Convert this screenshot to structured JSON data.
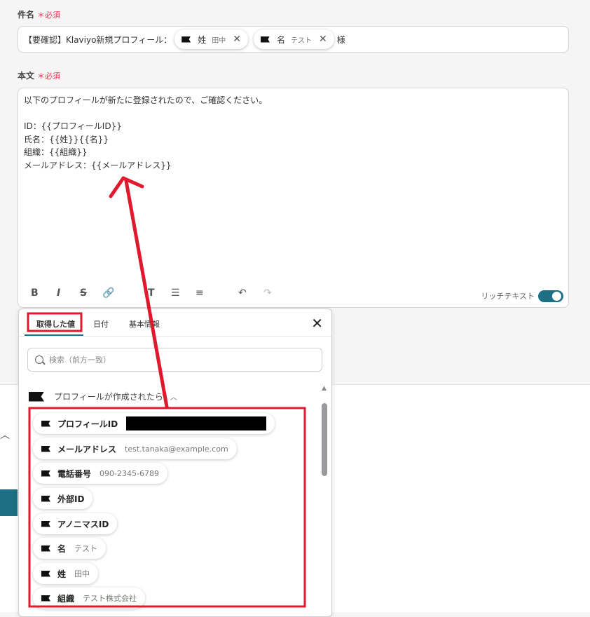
{
  "subject": {
    "label": "件名",
    "required": "＊必須",
    "prefix": "【要確認】Klaviyo新規プロフィール：",
    "chips": [
      {
        "label": "姓",
        "value": "田中"
      },
      {
        "label": "名",
        "value": "テスト"
      }
    ],
    "suffix": "様"
  },
  "body": {
    "label": "本文",
    "required": "＊必須",
    "text": "以下のプロフィールが新たに登録されたので、ご確認ください。\n\nID：{{プロフィールID}}\n氏名：{{姓}}{{名}}\n組織：{{組織}}\nメールアドレス：{{メールアドレス}}",
    "rich_text_label": "リッチテキスト",
    "rich_text_enabled": true
  },
  "popup": {
    "tabs": [
      "取得した値",
      "日付",
      "基本情報"
    ],
    "search_placeholder": "検索（前方一致）",
    "group_title": "プロフィールが作成されたら",
    "items": [
      {
        "label": "プロフィールID",
        "value": ""
      },
      {
        "label": "メールアドレス",
        "value": "test.tanaka@example.com"
      },
      {
        "label": "電話番号",
        "value": "090-2345-6789"
      },
      {
        "label": "外部ID",
        "value": ""
      },
      {
        "label": "アノニマスID",
        "value": ""
      },
      {
        "label": "名",
        "value": "テスト"
      },
      {
        "label": "姓",
        "value": "田中"
      },
      {
        "label": "組織",
        "value": "テスト株式会社"
      }
    ]
  },
  "colors": {
    "accent": "#1c6f84",
    "annotation": "#e0192f",
    "required": "#e23a55"
  }
}
